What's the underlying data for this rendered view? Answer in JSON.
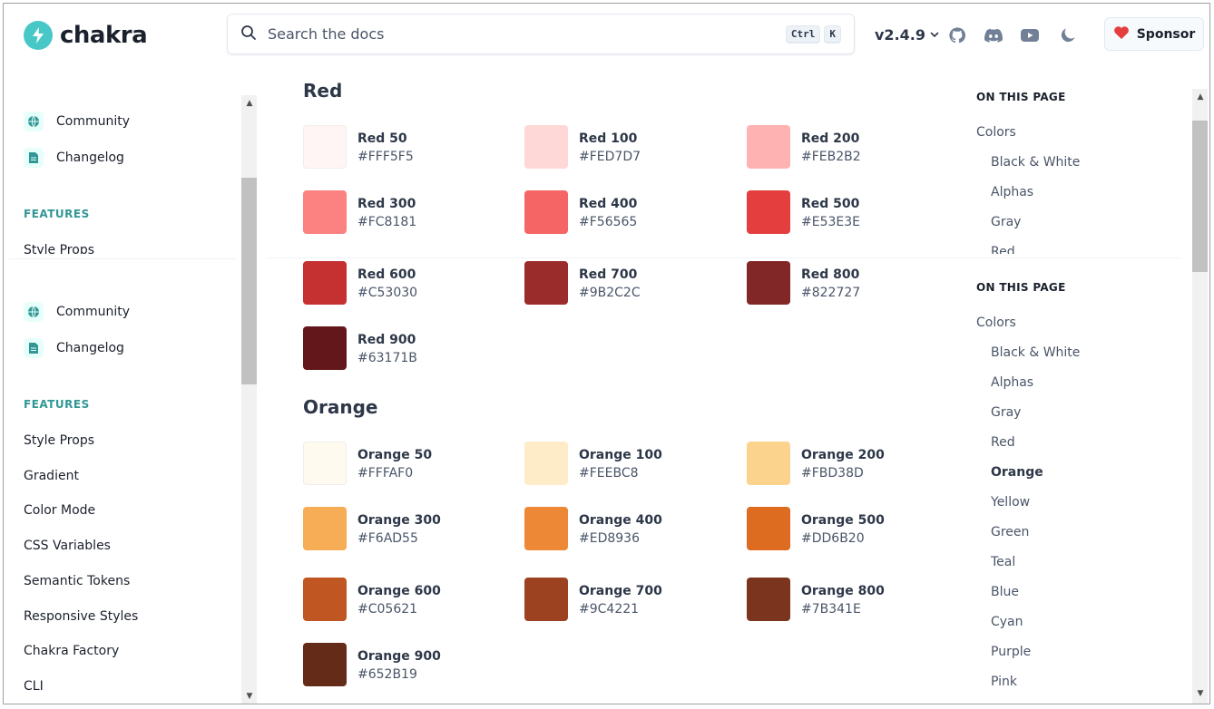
{
  "colors": {
    "accent": "#319795",
    "logo_mark": "#48c7c7",
    "text": "#1a202c",
    "muted": "#4a5568",
    "heart": "#e53e3e"
  },
  "header": {
    "logo_text": "chakra",
    "search_placeholder": "Search the docs",
    "kbd_ctrl": "Ctrl",
    "kbd_k": "K",
    "version": "v2.4.9",
    "icons": [
      "github-icon",
      "discord-icon",
      "youtube-icon",
      "moon-icon"
    ],
    "sponsor_label": "Sponsor"
  },
  "sidebar": {
    "top_links": [
      {
        "label": "Community",
        "icon": "globe-icon"
      },
      {
        "label": "Changelog",
        "icon": "document-icon"
      }
    ],
    "features_heading": "FEATURES",
    "clipped_item": "Style Props",
    "repeat_links": [
      {
        "label": "Community",
        "icon": "globe-icon"
      },
      {
        "label": "Changelog",
        "icon": "document-icon"
      }
    ],
    "features_heading_2": "FEATURES",
    "feature_items": [
      "Style Props",
      "Gradient",
      "Color Mode",
      "CSS Variables",
      "Semantic Tokens",
      "Responsive Styles",
      "Chakra Factory",
      "CLI"
    ]
  },
  "main": {
    "red_heading": "Red",
    "red_swatches": [
      {
        "name": "Red 50",
        "hex": "#FFF5F5"
      },
      {
        "name": "Red 100",
        "hex": "#FED7D7"
      },
      {
        "name": "Red 200",
        "hex": "#FEB2B2"
      },
      {
        "name": "Red 300",
        "hex": "#FC8181"
      },
      {
        "name": "Red 400",
        "hex": "#F56565"
      },
      {
        "name": "Red 500",
        "hex": "#E53E3E"
      },
      {
        "name": "Red 600",
        "hex": "#C53030"
      },
      {
        "name": "Red 700",
        "hex": "#9B2C2C"
      },
      {
        "name": "Red 800",
        "hex": "#822727"
      },
      {
        "name": "Red 900",
        "hex": "#63171B"
      }
    ],
    "orange_heading": "Orange",
    "orange_swatches": [
      {
        "name": "Orange 50",
        "hex": "#FFFAF0"
      },
      {
        "name": "Orange 100",
        "hex": "#FEEBC8"
      },
      {
        "name": "Orange 200",
        "hex": "#FBD38D"
      },
      {
        "name": "Orange 300",
        "hex": "#F6AD55"
      },
      {
        "name": "Orange 400",
        "hex": "#ED8936"
      },
      {
        "name": "Orange 500",
        "hex": "#DD6B20"
      },
      {
        "name": "Orange 600",
        "hex": "#C05621"
      },
      {
        "name": "Orange 700",
        "hex": "#9C4221"
      },
      {
        "name": "Orange 800",
        "hex": "#7B341E"
      },
      {
        "name": "Orange 900",
        "hex": "#652B19"
      }
    ]
  },
  "toc": {
    "heading": "ON THIS PAGE",
    "top_items": [
      "Colors",
      "Black & White",
      "Alphas",
      "Gray",
      "Red"
    ],
    "heading_2": "ON THIS PAGE",
    "items": [
      {
        "label": "Colors",
        "level": 1,
        "active": false
      },
      {
        "label": "Black & White",
        "level": 2,
        "active": false
      },
      {
        "label": "Alphas",
        "level": 2,
        "active": false
      },
      {
        "label": "Gray",
        "level": 2,
        "active": false
      },
      {
        "label": "Red",
        "level": 2,
        "active": false
      },
      {
        "label": "Orange",
        "level": 2,
        "active": true
      },
      {
        "label": "Yellow",
        "level": 2,
        "active": false
      },
      {
        "label": "Green",
        "level": 2,
        "active": false
      },
      {
        "label": "Teal",
        "level": 2,
        "active": false
      },
      {
        "label": "Blue",
        "level": 2,
        "active": false
      },
      {
        "label": "Cyan",
        "level": 2,
        "active": false
      },
      {
        "label": "Purple",
        "level": 2,
        "active": false
      },
      {
        "label": "Pink",
        "level": 2,
        "active": false
      }
    ]
  }
}
